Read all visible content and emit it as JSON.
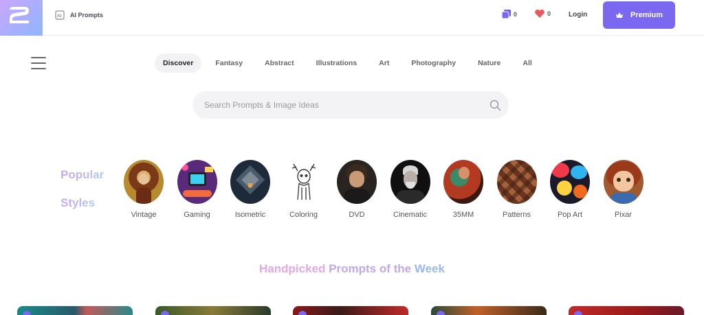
{
  "header": {
    "ai_prompts_label": "AI Prompts",
    "collections_count": "0",
    "likes_count": "0",
    "login_label": "Login",
    "premium_label": "Premium"
  },
  "nav": {
    "categories": [
      {
        "label": "Discover",
        "active": true
      },
      {
        "label": "Fantasy",
        "active": false
      },
      {
        "label": "Abstract",
        "active": false
      },
      {
        "label": "Illustrations",
        "active": false
      },
      {
        "label": "Art",
        "active": false
      },
      {
        "label": "Photography",
        "active": false
      },
      {
        "label": "Nature",
        "active": false
      },
      {
        "label": "All",
        "active": false
      }
    ]
  },
  "search": {
    "placeholder": "Search Prompts & Image Ideas",
    "value": ""
  },
  "popular": {
    "title_line1": "Popular",
    "title_line2": "Styles",
    "styles": [
      {
        "label": "Vintage",
        "icon": "vintage-portrait-thumb"
      },
      {
        "label": "Gaming",
        "icon": "gaming-console-thumb"
      },
      {
        "label": "Isometric",
        "icon": "isometric-building-thumb"
      },
      {
        "label": "Coloring",
        "icon": "coloring-deer-thumb"
      },
      {
        "label": "DVD",
        "icon": "dvd-portrait-thumb"
      },
      {
        "label": "Cinematic",
        "icon": "cinematic-portrait-thumb"
      },
      {
        "label": "35MM",
        "icon": "35mm-scene-thumb"
      },
      {
        "label": "Patterns",
        "icon": "patterns-thumb"
      },
      {
        "label": "Pop Art",
        "icon": "pop-art-thumb"
      },
      {
        "label": "Pixar",
        "icon": "pixar-character-thumb"
      }
    ]
  },
  "handpicked": {
    "part1": "Handpicked",
    "part2": "Prompts of the",
    "part3": "Week"
  },
  "colors": {
    "accent": "#7b68f0",
    "heart": "#e85a5a",
    "popular_gradient_start": "#c9a6f5",
    "popular_gradient_end": "#b6c8f5"
  }
}
